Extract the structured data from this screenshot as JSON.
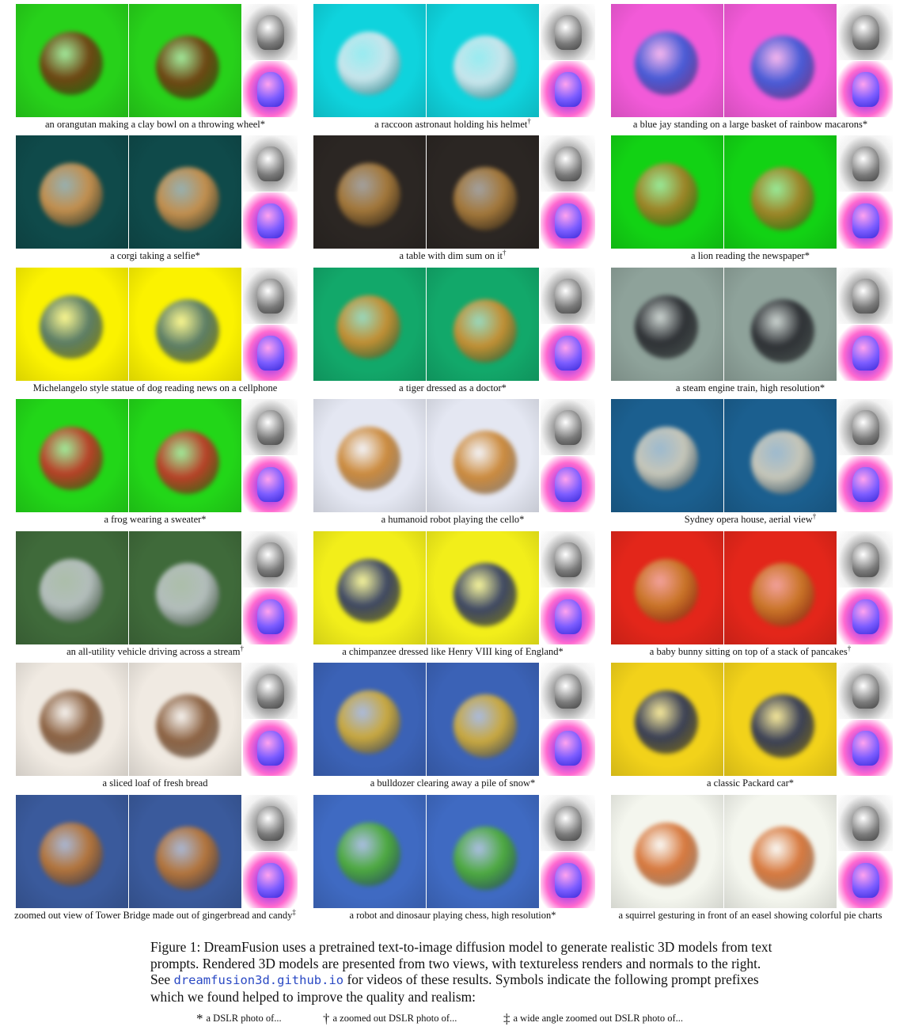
{
  "figure": {
    "rows": [
      [
        {
          "caption": "an orangutan making a clay bowl on a throwing wheel",
          "symbol": "*",
          "bg": "#27d11a",
          "subject": "#7a2e12"
        },
        {
          "caption": "a raccoon astronaut holding his helmet",
          "symbol": "†",
          "bg": "#0fd3dd",
          "subject": "#e8e8ee"
        },
        {
          "caption": "a blue jay standing on a large basket of rainbow macarons",
          "symbol": "*",
          "bg": "#f25ad8",
          "subject": "#2a5bd6"
        }
      ],
      [
        {
          "caption": "a corgi taking a selfie",
          "symbol": "*",
          "bg": "#0f4a4a",
          "subject": "#e19a4e"
        },
        {
          "caption": "a table with dim sum on it",
          "symbol": "†",
          "bg": "#2b2623",
          "subject": "#b7853e"
        },
        {
          "caption": "a lion reading the newspaper",
          "symbol": "*",
          "bg": "#12d214",
          "subject": "#b5762a"
        }
      ],
      [
        {
          "caption": "Michelangelo style statue of dog reading news on a cellphone",
          "symbol": "",
          "bg": "#fbf200",
          "subject": "#3f6878"
        },
        {
          "caption": "a tiger dressed as a doctor",
          "symbol": "*",
          "bg": "#12a86a",
          "subject": "#e08a2a"
        },
        {
          "caption": "a steam engine train, high resolution",
          "symbol": "*",
          "bg": "#8ea29a",
          "subject": "#1e1e24"
        }
      ],
      [
        {
          "caption": "a frog wearing a sweater",
          "symbol": "*",
          "bg": "#22d618",
          "subject": "#d2262a"
        },
        {
          "caption": "a humanoid robot playing the cello",
          "symbol": "*",
          "bg": "#e4e7f2",
          "subject": "#c77a1e"
        },
        {
          "caption": "Sydney opera house, aerial view",
          "symbol": "†",
          "bg": "#1b5f8f",
          "subject": "#e4d8c0"
        }
      ],
      [
        {
          "caption": "an all-utility vehicle driving across a stream",
          "symbol": "†",
          "bg": "#3f6a3a",
          "subject": "#c7ccd2"
        },
        {
          "caption": "a chimpanzee dressed like Henry VIII king of England",
          "symbol": "*",
          "bg": "#f2ee1a",
          "subject": "#1e2a70"
        },
        {
          "caption": "a baby bunny sitting on top of a stack of pancakes",
          "symbol": "†",
          "bg": "#e3261a",
          "subject": "#c5822a"
        }
      ],
      [
        {
          "caption": "a sliced loaf of fresh bread",
          "symbol": "",
          "bg": "#f0eae2",
          "subject": "#7a4a26"
        },
        {
          "caption": "a bulldozer clearing away a pile of snow",
          "symbol": "*",
          "bg": "#3b62b6",
          "subject": "#e1b42a"
        },
        {
          "caption": "a classic Packard car",
          "symbol": "*",
          "bg": "#f2d21a",
          "subject": "#1a2660"
        }
      ],
      [
        {
          "caption": "zoomed out view of Tower Bridge made out of gingerbread and candy",
          "symbol": "‡",
          "bg": "#3a5a9c",
          "subject": "#c7782a"
        },
        {
          "caption": "a robot and dinosaur playing chess, high resolution",
          "symbol": "*",
          "bg": "#3f6ac2",
          "subject": "#4fb428"
        },
        {
          "caption": "a squirrel gesturing in front of an easel showing colorful pie charts",
          "symbol": "",
          "bg": "#f4f6ee",
          "subject": "#d2621e"
        }
      ]
    ],
    "caption_label": "Figure 1:",
    "caption_text_1": "DreamFusion uses a pretrained text-to-image diffusion model to generate realistic 3D models from text prompts. Rendered 3D models are presented from two views, with textureless renders and normals to the right. See",
    "caption_link": "dreamfusion3d.github.io",
    "caption_text_2": "for videos of these results. Symbols indicate the following prompt prefixes which we found helped to improve the quality and realism:",
    "legend": [
      {
        "symbol": "*",
        "text": "a DSLR photo of..."
      },
      {
        "symbol": "†",
        "text": "a zoomed out DSLR photo of..."
      },
      {
        "symbol": "‡",
        "text": "a wide angle zoomed out DSLR photo of..."
      }
    ]
  }
}
